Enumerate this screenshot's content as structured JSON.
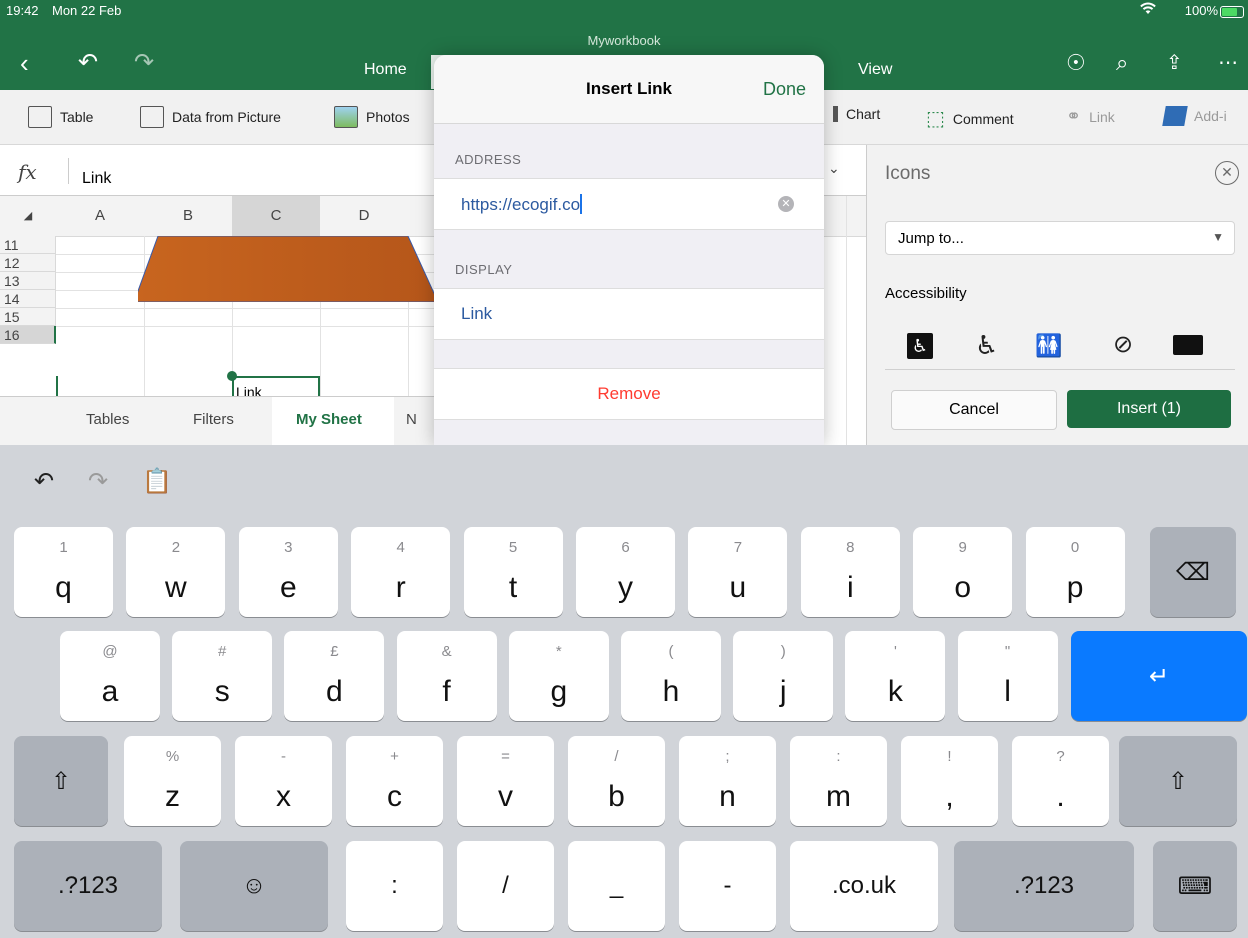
{
  "status": {
    "time": "19:42",
    "date": "Mon 22 Feb",
    "battery": "100%",
    "wifi_icon": "wifi-icon"
  },
  "app": {
    "document_name": "Myworkbook",
    "tabs": {
      "home": "Home",
      "view": "View"
    }
  },
  "ribbon": {
    "table": "Table",
    "data_from_picture": "Data from Picture",
    "photos": "Photos",
    "chart": "Chart",
    "comment": "Comment",
    "link": "Link",
    "addins": "Add-i"
  },
  "formula": {
    "label": "fx",
    "value": "Link"
  },
  "grid": {
    "columns": [
      "A",
      "B",
      "C",
      "D"
    ],
    "rows": [
      "11",
      "12",
      "13",
      "14",
      "15",
      "16"
    ],
    "cell_text": "Link"
  },
  "sheets": [
    "Tables",
    "Filters",
    "My Sheet",
    "N"
  ],
  "modal": {
    "title": "Insert Link",
    "done": "Done",
    "address_label": "ADDRESS",
    "address_value": "https://ecogif.co",
    "display_label": "DISPLAY",
    "display_value": "Link",
    "remove": "Remove"
  },
  "panel": {
    "title": "Icons",
    "jump": "Jump to...",
    "category": "Accessibility",
    "cancel": "Cancel",
    "insert": "Insert (1)",
    "icon_glyphs": [
      "♿",
      "🦽",
      "👪",
      "🦻",
      "💬"
    ]
  },
  "keyboard": {
    "row1": [
      [
        "1",
        "q"
      ],
      [
        "2",
        "w"
      ],
      [
        "3",
        "e"
      ],
      [
        "4",
        "r"
      ],
      [
        "5",
        "t"
      ],
      [
        "6",
        "y"
      ],
      [
        "7",
        "u"
      ],
      [
        "8",
        "i"
      ],
      [
        "9",
        "o"
      ],
      [
        "0",
        "p"
      ]
    ],
    "row2": [
      [
        "@",
        "a"
      ],
      [
        "#",
        "s"
      ],
      [
        "£",
        "d"
      ],
      [
        "&",
        "f"
      ],
      [
        "*",
        "g"
      ],
      [
        "(",
        "h"
      ],
      [
        ")",
        "j"
      ],
      [
        "'",
        "k"
      ],
      [
        "\"",
        "l"
      ]
    ],
    "row3": [
      [
        "%",
        "z"
      ],
      [
        "-",
        "x"
      ],
      [
        "+",
        "c"
      ],
      [
        "=",
        "v"
      ],
      [
        "/",
        "b"
      ],
      [
        ";",
        "n"
      ],
      [
        ":",
        "m"
      ],
      [
        "!",
        ","
      ],
      [
        "?",
        "."
      ]
    ],
    "row4": {
      "numbers_left": ".?123",
      "colon": ":",
      "slash": "/",
      "underscore": "_",
      "dash": "-",
      "tld": ".co.uk",
      "numbers_right": ".?123"
    }
  }
}
